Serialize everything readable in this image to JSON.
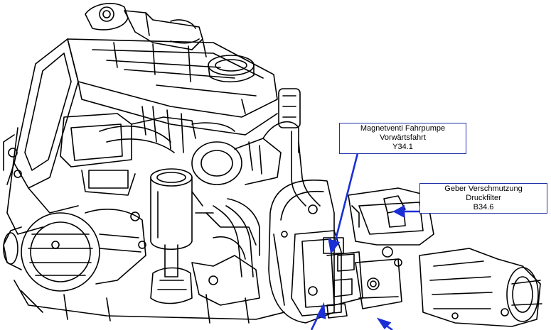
{
  "callouts": [
    {
      "line1": "Magnetventi Fahrpumpe",
      "line2": "Vorwärtsfahrt",
      "code": "Y34.1"
    },
    {
      "line1": "Geber Verschmutzung",
      "line2": "Druckfilter",
      "code": "B34.6"
    }
  ],
  "colors": {
    "leader": "#1a2fd6",
    "outline": "#000000",
    "box_border": "#2233aa"
  }
}
